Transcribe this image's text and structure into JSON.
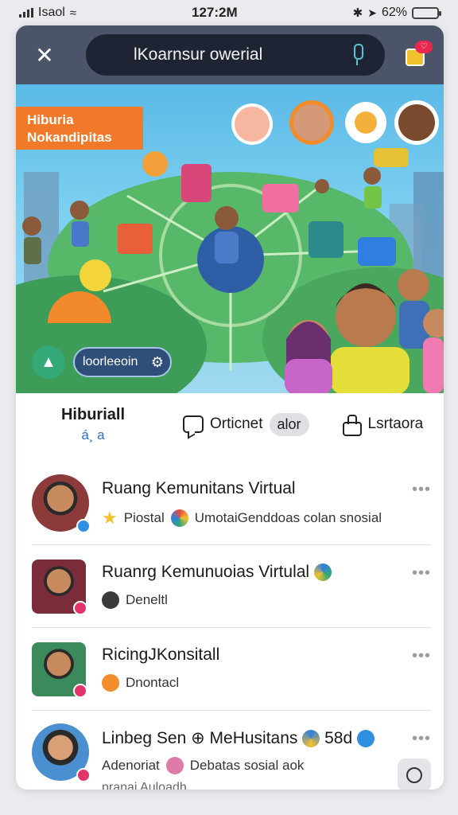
{
  "status_bar": {
    "carrier": "Isaol",
    "time": "127:2M",
    "battery": "62%",
    "battery_level": 0.62
  },
  "top_bar": {
    "search_text": "lKoarnsur owerial",
    "icons": [
      "tools-icon",
      "mic-icon",
      "notification-icon"
    ]
  },
  "hero": {
    "label_line1": "Hiburia",
    "label_line2": "Nokandipitas",
    "chip_text": "loorleeoin"
  },
  "tabs": {
    "hiburan_title": "Hiburiall",
    "hiburan_sub": "á¸ a",
    "orient_label": "Orticnet",
    "orient_pill": "alor",
    "lastaora_label": "Lsrtaora"
  },
  "list": [
    {
      "title": "Ruang Kemunitans Virtual",
      "sub_label": "Piostal",
      "sub_text": "UmotaiGenddoas colan snosial",
      "more": "•••",
      "dot_color": "#2f8fe0"
    },
    {
      "title": "Ruanrg Kemunuoias Virtulal",
      "sub_label": "Deneltl",
      "more": "•••",
      "dot_color": "#e0346b"
    },
    {
      "title": "RicingJKonsitall",
      "sub_label": "Dnontacl",
      "more": "•••",
      "dot_color": "#e0346b"
    },
    {
      "title": "Linbeg Sen ⊕ MeHusitans",
      "title_extra": "58d",
      "sub_label": "Adenoriat",
      "sub_text": "Debatas sosial aok",
      "line3": "pranai Auloadh",
      "more": "•••",
      "dot_color": "#e0346b"
    }
  ]
}
